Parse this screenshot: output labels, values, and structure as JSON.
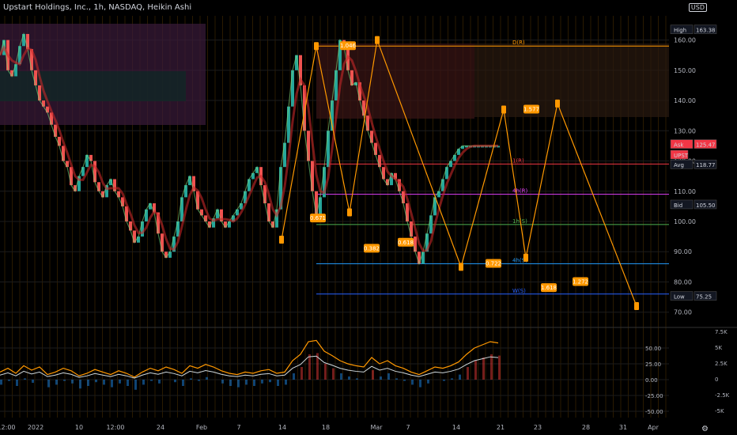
{
  "header": {
    "title": "Upstart Holdings, Inc., 1h, NASDAQ, Heikin Ashi",
    "currency": "USD"
  },
  "chart_data": {
    "type": "line",
    "title": "Upstart Holdings, Inc., 1h, NASDAQ, Heikin Ashi",
    "xlabel": "",
    "ylabel": "",
    "ylim": [
      66,
      168
    ],
    "y_ticks": [
      160,
      150,
      140,
      130,
      120,
      110,
      100,
      90,
      80,
      70
    ],
    "x_ticks": [
      "12:00",
      "2022",
      "10",
      "12:00",
      "24",
      "Feb",
      "7",
      "14",
      "18",
      "Mar",
      "7",
      "14",
      "21",
      "23",
      "28",
      "31",
      "Apr"
    ],
    "price_labels": [
      {
        "name": "High",
        "value": "163.38",
        "color": "#131722"
      },
      {
        "name": "Ask",
        "value": "125.47",
        "color": "#f23645"
      },
      {
        "name": "UPST",
        "value": "",
        "color": "#f23645"
      },
      {
        "name": "Avg",
        "value": "118.77",
        "color": "#131722"
      },
      {
        "name": "Bid",
        "value": "105.50",
        "color": "#131722"
      },
      {
        "name": "Low",
        "value": "75.25",
        "color": "#131722"
      }
    ],
    "series": [
      {
        "type": "price",
        "x": [
          0,
          5,
          10,
          15,
          20,
          25,
          30,
          35,
          40,
          45,
          50,
          55,
          60,
          65,
          70,
          75,
          80,
          85,
          90,
          95,
          100,
          105,
          110,
          115,
          120,
          125,
          130,
          135,
          140,
          145,
          150,
          155,
          160,
          165,
          170,
          175,
          180,
          185,
          190,
          195,
          200,
          205,
          210,
          215,
          220,
          225,
          230,
          235,
          240,
          245,
          250,
          255,
          260,
          265,
          270,
          275,
          280,
          285,
          290,
          295,
          300,
          305,
          310,
          315,
          320,
          325,
          330,
          335,
          340,
          345,
          350,
          355,
          360,
          365,
          370,
          375,
          380,
          385,
          390,
          395,
          400,
          405,
          410,
          415,
          420,
          425,
          430,
          435,
          440,
          445,
          450,
          455,
          460,
          465,
          470,
          475,
          480,
          485,
          490,
          495,
          500,
          505,
          510,
          515,
          520,
          525,
          530,
          535,
          540,
          545,
          550,
          555,
          560,
          565,
          570,
          575,
          580,
          585,
          590,
          595,
          600,
          605,
          610,
          615,
          620,
          625,
          630
        ],
        "values": [
          155,
          160,
          150,
          148,
          152,
          158,
          162,
          157,
          150,
          145,
          140,
          138,
          136,
          132,
          128,
          125,
          120,
          118,
          112,
          110,
          115,
          118,
          122,
          120,
          113,
          110,
          108,
          112,
          114,
          110,
          108,
          105,
          100,
          97,
          93,
          95,
          100,
          104,
          106,
          103,
          96,
          90,
          88,
          90,
          95,
          100,
          108,
          112,
          115,
          110,
          104,
          102,
          100,
          98,
          101,
          104,
          100,
          98,
          100,
          102,
          104,
          106,
          110,
          114,
          116,
          118,
          112,
          106,
          100,
          98,
          104,
          118,
          126,
          138,
          150,
          155,
          145,
          130,
          120,
          110,
          102,
          108,
          118,
          130,
          140,
          150,
          160,
          158,
          150,
          145,
          146,
          140,
          135,
          130,
          126,
          122,
          118,
          114,
          112,
          116,
          114,
          110,
          106,
          100,
          95,
          90,
          86,
          90,
          96,
          102,
          108,
          110,
          114,
          118,
          120,
          122,
          124,
          125,
          125,
          125,
          125,
          125,
          125,
          125,
          125,
          125,
          125
        ]
      },
      {
        "type": "projection",
        "x": [
          356,
          400,
          442,
          477,
          583,
          637,
          665,
          705,
          805
        ],
        "values": [
          94,
          158,
          103,
          160,
          85,
          137,
          88,
          139,
          72
        ],
        "color": "#ff9800"
      }
    ],
    "pattern_labels": [
      {
        "text": "1.046",
        "x": 440,
        "y": 158
      },
      {
        "text": "1.577",
        "x": 672,
        "y": 137
      },
      {
        "text": "0.382",
        "x": 470,
        "y": 91
      },
      {
        "text": "0.618",
        "x": 513,
        "y": 93
      },
      {
        "text": "0.671",
        "x": 402,
        "y": 101
      },
      {
        "text": "0.722",
        "x": 624,
        "y": 86
      },
      {
        "text": "1.272",
        "x": 734,
        "y": 80
      },
      {
        "text": "1.618",
        "x": 694,
        "y": 78
      }
    ],
    "level_labels": [
      {
        "text": "D(R)",
        "x": 648,
        "y": 158
      },
      {
        "text": "1(R)",
        "x": 648,
        "y": 119
      },
      {
        "text": "4h(R)",
        "x": 648,
        "y": 109
      },
      {
        "text": "1h(S)",
        "x": 648,
        "y": 99
      },
      {
        "text": "4h(S)",
        "x": 648,
        "y": 86
      },
      {
        "text": "W(S)",
        "x": 648,
        "y": 76
      }
    ],
    "oscillator": {
      "ylim": [
        -60,
        75
      ],
      "y_ticks_left": [
        50.0,
        25.0,
        0.0,
        -25.0,
        -50.0
      ],
      "y_ticks_right": [
        "7.5K",
        "5K",
        "2.5K",
        "0",
        "-2.5K",
        "-5K"
      ],
      "x": [
        0,
        10,
        20,
        30,
        40,
        50,
        60,
        70,
        80,
        90,
        100,
        110,
        120,
        130,
        140,
        150,
        160,
        170,
        180,
        190,
        200,
        210,
        220,
        230,
        240,
        250,
        260,
        270,
        280,
        290,
        300,
        310,
        320,
        330,
        340,
        350,
        360,
        370,
        380,
        390,
        400,
        410,
        420,
        430,
        440,
        450,
        460,
        470,
        480,
        490,
        500,
        510,
        520,
        530,
        540,
        550,
        560,
        570,
        580,
        590,
        600,
        610,
        620,
        630
      ],
      "values": [
        12,
        18,
        10,
        22,
        15,
        20,
        8,
        12,
        18,
        14,
        6,
        10,
        16,
        12,
        8,
        14,
        10,
        4,
        12,
        18,
        14,
        20,
        16,
        10,
        22,
        18,
        24,
        20,
        14,
        10,
        8,
        12,
        10,
        14,
        16,
        10,
        12,
        30,
        40,
        60,
        62,
        45,
        38,
        30,
        25,
        22,
        20,
        35,
        25,
        30,
        22,
        18,
        12,
        8,
        14,
        20,
        18,
        22,
        28,
        40,
        50,
        55,
        60,
        58
      ]
    }
  }
}
